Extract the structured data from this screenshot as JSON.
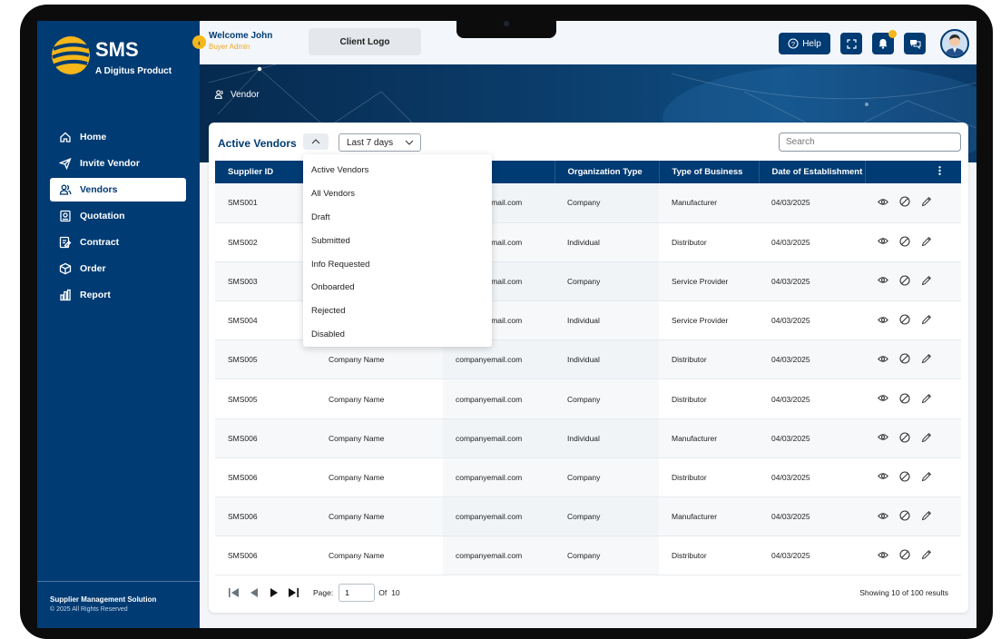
{
  "brand": {
    "title": "SMS",
    "subtitle": "A Digitus Product"
  },
  "nav": [
    {
      "label": "Home",
      "icon": "home-icon"
    },
    {
      "label": "Invite Vendor",
      "icon": "send-icon"
    },
    {
      "label": "Vendors",
      "icon": "users-icon",
      "active": true
    },
    {
      "label": "Quotation",
      "icon": "quotation-icon"
    },
    {
      "label": "Contract",
      "icon": "contract-icon"
    },
    {
      "label": "Order",
      "icon": "box-icon"
    },
    {
      "label": "Report",
      "icon": "bar-chart-icon"
    }
  ],
  "sidebar_footer": {
    "title": "Supplier Management Solution",
    "copyright": "© 2025 All Rights Reserved"
  },
  "header": {
    "welcome": "Welcome John",
    "role": "Buyer Admin",
    "client_logo": "Client Logo",
    "help": "Help"
  },
  "breadcrumb": "Vendor",
  "card": {
    "title": "Active Vendors",
    "date_filter": "Last 7 days",
    "search_placeholder": "Search"
  },
  "table": {
    "columns": [
      "Supplier ID",
      "",
      "",
      "Organization Type",
      "Type of Business",
      "Date of Establishment"
    ],
    "rows": [
      [
        "SMS001",
        "",
        "companyemail.com",
        "Company",
        "Manufacturer",
        "04/03/2025"
      ],
      [
        "SMS002",
        "",
        "companyemail.com",
        "Individual",
        "Distributor",
        "04/03/2025"
      ],
      [
        "SMS003",
        "",
        "companyemail.com",
        "Company",
        "Service Provider",
        "04/03/2025"
      ],
      [
        "SMS004",
        "",
        "companyemail.com",
        "Individual",
        "Service Provider",
        "04/03/2025"
      ],
      [
        "SMS005",
        "Company Name",
        "companyemail.com",
        "Individual",
        "Distributor",
        "04/03/2025"
      ],
      [
        "SMS005",
        "Company Name",
        "companyemail.com",
        "Company",
        "Distributor",
        "04/03/2025"
      ],
      [
        "SMS006",
        "Company Name",
        "companyemail.com",
        "Individual",
        "Manufacturer",
        "04/03/2025"
      ],
      [
        "SMS006",
        "Company Name",
        "companyemail.com",
        "Company",
        "Distributor",
        "04/03/2025"
      ],
      [
        "SMS006",
        "Company Name",
        "companyemail.com",
        "Company",
        "Manufacturer",
        "04/03/2025"
      ],
      [
        "SMS006",
        "Company Name",
        "companyemail.com",
        "Company",
        "Distributor",
        "04/03/2025"
      ]
    ]
  },
  "pagination": {
    "page_label": "Page:",
    "page": "1",
    "of_label": "Of",
    "total_pages": "10",
    "showing": "Showing 10 of 100 results"
  },
  "status_dropdown": [
    "Active Vendors",
    "All Vendors",
    "Draft",
    "Submitted",
    "Info Requested",
    "Onboarded",
    "Rejected",
    "Disabled"
  ],
  "colors": {
    "primary": "#003b73",
    "accent": "#f5b71a"
  }
}
